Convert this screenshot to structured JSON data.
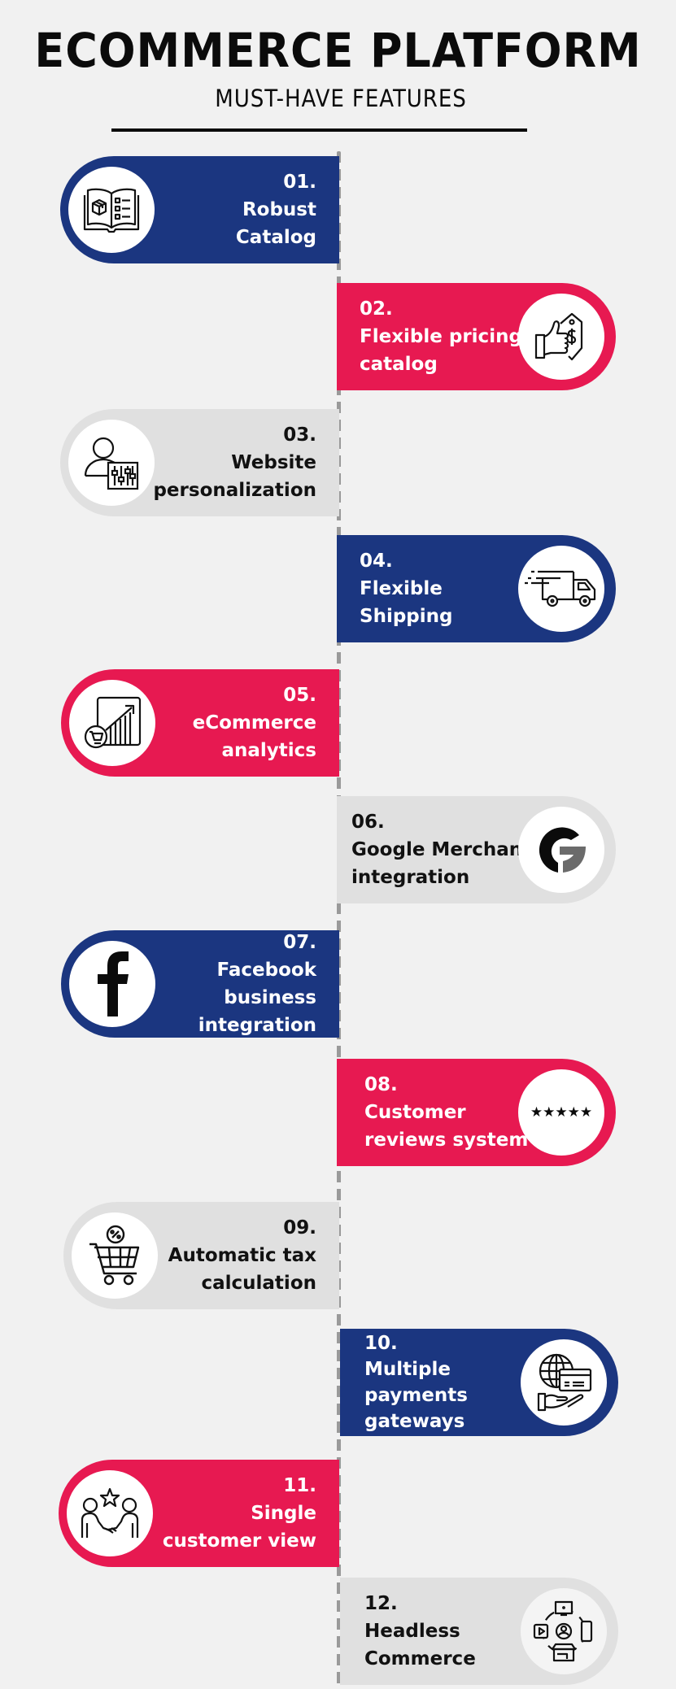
{
  "header": {
    "title": "ECOMMERCE PLATFORM",
    "subtitle": "MUST-HAVE FEATURES"
  },
  "colors": {
    "blue": "#1b3680",
    "pink": "#e71951",
    "grey": "#e0e0e0",
    "background": "#f1f1f1"
  },
  "features": [
    {
      "number": "01.",
      "lines": [
        "Robust",
        "Catalog"
      ],
      "icon": "catalog-book-icon",
      "color": "blue",
      "side": "left"
    },
    {
      "number": "02.",
      "lines": [
        "Flexible pricing",
        "catalog"
      ],
      "icon": "thumbs-up-price-tag-icon",
      "color": "pink",
      "side": "right"
    },
    {
      "number": "03.",
      "lines": [
        "Website",
        "personalization"
      ],
      "icon": "user-settings-sliders-icon",
      "color": "grey",
      "side": "left"
    },
    {
      "number": "04.",
      "lines": [
        "Flexible",
        "Shipping"
      ],
      "icon": "delivery-truck-icon",
      "color": "blue",
      "side": "right"
    },
    {
      "number": "05.",
      "lines": [
        "eCommerce",
        "analytics"
      ],
      "icon": "analytics-chart-cart-icon",
      "color": "pink",
      "side": "left"
    },
    {
      "number": "06.",
      "lines": [
        "Google Merchant",
        "integration"
      ],
      "icon": "google-g-icon",
      "color": "grey",
      "side": "right"
    },
    {
      "number": "07.",
      "lines": [
        "Facebook",
        "business",
        "integration"
      ],
      "icon": "facebook-f-icon",
      "color": "blue",
      "side": "left"
    },
    {
      "number": "08.",
      "lines": [
        "Customer",
        "reviews system"
      ],
      "icon": "five-stars-icon",
      "stars": "★★★★★",
      "color": "pink",
      "side": "right"
    },
    {
      "number": "09.",
      "lines": [
        "Automatic tax",
        "calculation"
      ],
      "icon": "shopping-cart-percent-icon",
      "color": "grey",
      "side": "left"
    },
    {
      "number": "10.",
      "lines": [
        "Multiple",
        "payments",
        "gateways"
      ],
      "icon": "globe-card-hand-icon",
      "color": "blue",
      "side": "right"
    },
    {
      "number": "11.",
      "lines": [
        "Single",
        "customer view"
      ],
      "icon": "handshake-star-icon",
      "color": "pink",
      "side": "left"
    },
    {
      "number": "12.",
      "lines": [
        "Headless",
        "Commerce"
      ],
      "icon": "omnichannel-devices-icon",
      "color": "grey",
      "side": "right"
    }
  ]
}
